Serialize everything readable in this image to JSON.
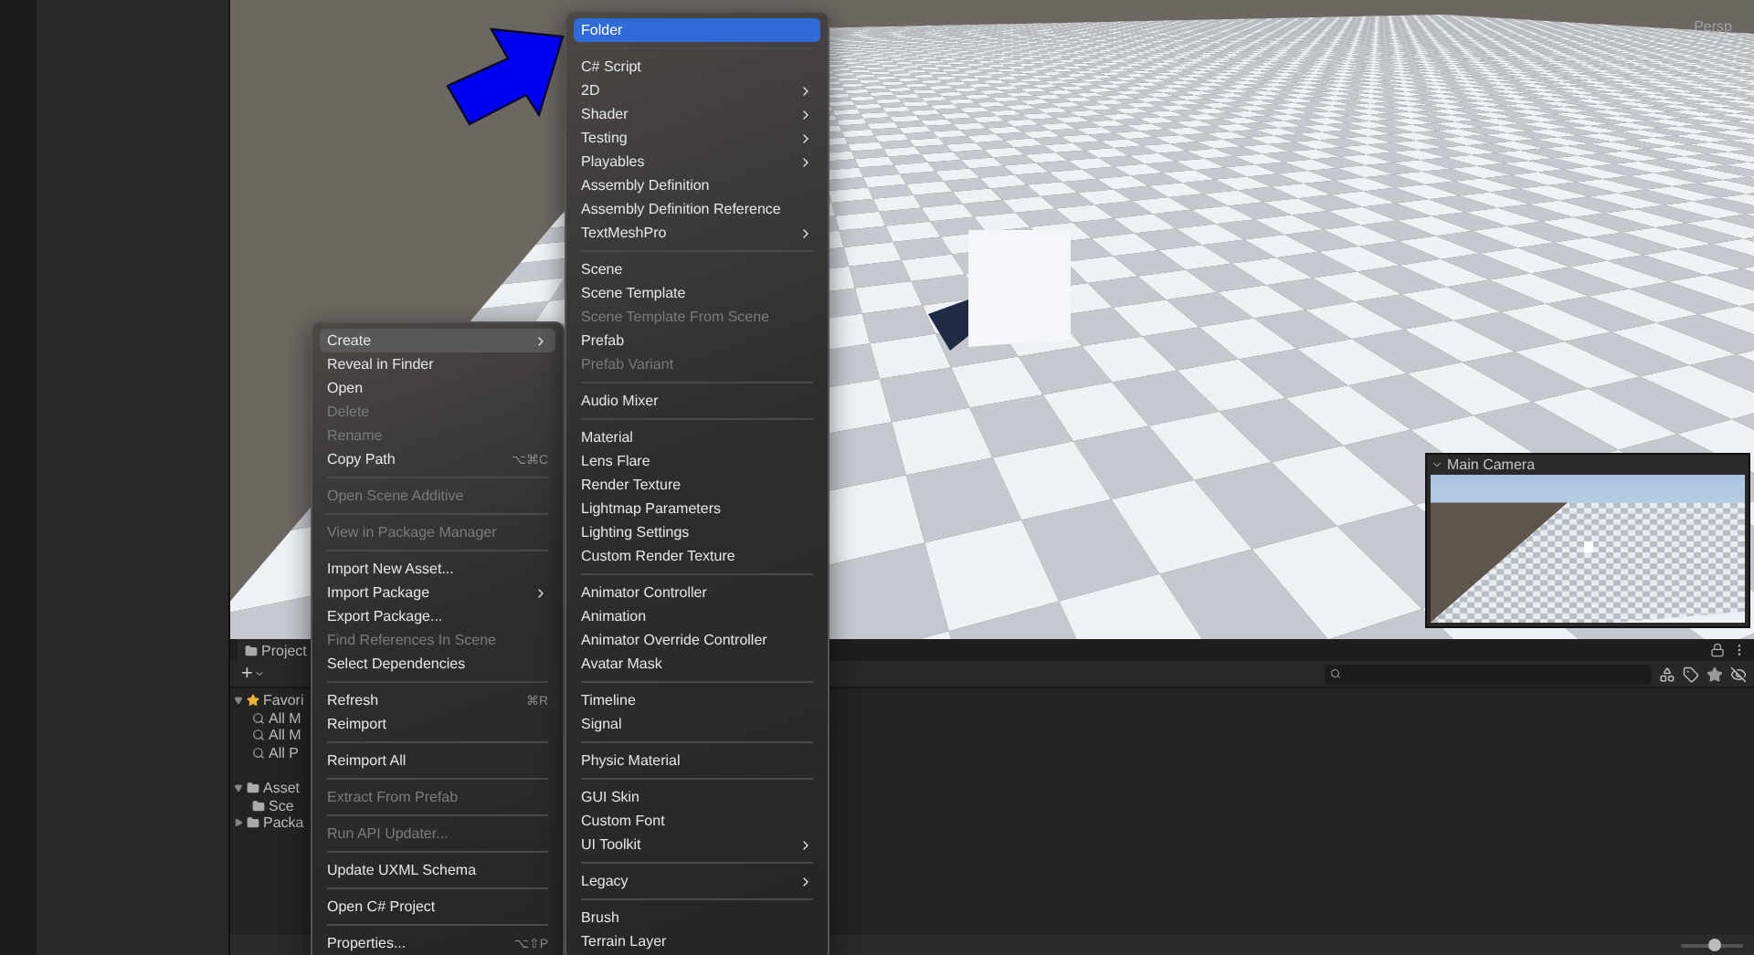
{
  "scene_view": {
    "camera_mode": "Persp",
    "camera_preview": {
      "title": "Main Camera",
      "expanded": true
    }
  },
  "project_panel": {
    "tab": "Project",
    "add_label": "+",
    "tree": [
      {
        "label": "Favori",
        "kind": "favorites",
        "expanded": true,
        "children": [
          {
            "label": "All M",
            "kind": "search"
          },
          {
            "label": "All M",
            "kind": "search"
          },
          {
            "label": "All P",
            "kind": "search"
          }
        ]
      },
      {
        "label": "Asset",
        "kind": "folder",
        "expanded": true,
        "children": [
          {
            "label": "Sce",
            "kind": "folder"
          }
        ]
      },
      {
        "label": "Packa",
        "kind": "folder",
        "expanded": false
      }
    ],
    "zoom_slider": {
      "level": 0.55
    }
  },
  "context_menu": {
    "focused": false,
    "items": [
      {
        "kind": "item",
        "label": "Create",
        "submenu": true,
        "selected": true,
        "disabled": false
      },
      {
        "kind": "item",
        "label": "Reveal in Finder",
        "selected": false,
        "disabled": false
      },
      {
        "kind": "item",
        "label": "Open",
        "selected": false,
        "disabled": false
      },
      {
        "kind": "item",
        "label": "Delete",
        "selected": false,
        "disabled": true
      },
      {
        "kind": "item",
        "label": "Rename",
        "selected": false,
        "disabled": true
      },
      {
        "kind": "item",
        "label": "Copy Path",
        "shortcut": "⌥⌘C",
        "selected": false,
        "disabled": false
      },
      {
        "kind": "separator"
      },
      {
        "kind": "item",
        "label": "Open Scene Additive",
        "selected": false,
        "disabled": true
      },
      {
        "kind": "separator"
      },
      {
        "kind": "item",
        "label": "View in Package Manager",
        "selected": false,
        "disabled": true
      },
      {
        "kind": "separator"
      },
      {
        "kind": "item",
        "label": "Import New Asset...",
        "selected": false,
        "disabled": false
      },
      {
        "kind": "item",
        "label": "Import Package",
        "submenu": true,
        "selected": false,
        "disabled": false
      },
      {
        "kind": "item",
        "label": "Export Package...",
        "selected": false,
        "disabled": false
      },
      {
        "kind": "item",
        "label": "Find References In Scene",
        "selected": false,
        "disabled": true
      },
      {
        "kind": "item",
        "label": "Select Dependencies",
        "selected": false,
        "disabled": false
      },
      {
        "kind": "separator"
      },
      {
        "kind": "item",
        "label": "Refresh",
        "shortcut": "⌘R",
        "selected": false,
        "disabled": false
      },
      {
        "kind": "item",
        "label": "Reimport",
        "selected": false,
        "disabled": false
      },
      {
        "kind": "separator"
      },
      {
        "kind": "item",
        "label": "Reimport All",
        "selected": false,
        "disabled": false
      },
      {
        "kind": "separator"
      },
      {
        "kind": "item",
        "label": "Extract From Prefab",
        "selected": false,
        "disabled": true
      },
      {
        "kind": "separator"
      },
      {
        "kind": "item",
        "label": "Run API Updater...",
        "selected": false,
        "disabled": true
      },
      {
        "kind": "separator"
      },
      {
        "kind": "item",
        "label": "Update UXML Schema",
        "selected": false,
        "disabled": false
      },
      {
        "kind": "separator"
      },
      {
        "kind": "item",
        "label": "Open C# Project",
        "selected": false,
        "disabled": false
      },
      {
        "kind": "separator"
      },
      {
        "kind": "item",
        "label": "Properties...",
        "shortcut": "⌥⇧P",
        "selected": false,
        "disabled": false
      }
    ]
  },
  "create_submenu": {
    "focused": true,
    "items": [
      {
        "kind": "item",
        "label": "Folder",
        "selected": true,
        "disabled": false
      },
      {
        "kind": "separator"
      },
      {
        "kind": "item",
        "label": "C# Script",
        "selected": false,
        "disabled": false
      },
      {
        "kind": "item",
        "label": "2D",
        "submenu": true,
        "selected": false,
        "disabled": false
      },
      {
        "kind": "item",
        "label": "Shader",
        "submenu": true,
        "selected": false,
        "disabled": false
      },
      {
        "kind": "item",
        "label": "Testing",
        "submenu": true,
        "selected": false,
        "disabled": false
      },
      {
        "kind": "item",
        "label": "Playables",
        "submenu": true,
        "selected": false,
        "disabled": false
      },
      {
        "kind": "item",
        "label": "Assembly Definition",
        "selected": false,
        "disabled": false
      },
      {
        "kind": "item",
        "label": "Assembly Definition Reference",
        "selected": false,
        "disabled": false
      },
      {
        "kind": "item",
        "label": "TextMeshPro",
        "submenu": true,
        "selected": false,
        "disabled": false
      },
      {
        "kind": "separator"
      },
      {
        "kind": "item",
        "label": "Scene",
        "selected": false,
        "disabled": false
      },
      {
        "kind": "item",
        "label": "Scene Template",
        "selected": false,
        "disabled": false
      },
      {
        "kind": "item",
        "label": "Scene Template From Scene",
        "selected": false,
        "disabled": true
      },
      {
        "kind": "item",
        "label": "Prefab",
        "selected": false,
        "disabled": false
      },
      {
        "kind": "item",
        "label": "Prefab Variant",
        "selected": false,
        "disabled": true
      },
      {
        "kind": "separator"
      },
      {
        "kind": "item",
        "label": "Audio Mixer",
        "selected": false,
        "disabled": false
      },
      {
        "kind": "separator"
      },
      {
        "kind": "item",
        "label": "Material",
        "selected": false,
        "disabled": false
      },
      {
        "kind": "item",
        "label": "Lens Flare",
        "selected": false,
        "disabled": false
      },
      {
        "kind": "item",
        "label": "Render Texture",
        "selected": false,
        "disabled": false
      },
      {
        "kind": "item",
        "label": "Lightmap Parameters",
        "selected": false,
        "disabled": false
      },
      {
        "kind": "item",
        "label": "Lighting Settings",
        "selected": false,
        "disabled": false
      },
      {
        "kind": "item",
        "label": "Custom Render Texture",
        "selected": false,
        "disabled": false
      },
      {
        "kind": "separator"
      },
      {
        "kind": "item",
        "label": "Animator Controller",
        "selected": false,
        "disabled": false
      },
      {
        "kind": "item",
        "label": "Animation",
        "selected": false,
        "disabled": false
      },
      {
        "kind": "item",
        "label": "Animator Override Controller",
        "selected": false,
        "disabled": false
      },
      {
        "kind": "item",
        "label": "Avatar Mask",
        "selected": false,
        "disabled": false
      },
      {
        "kind": "separator"
      },
      {
        "kind": "item",
        "label": "Timeline",
        "selected": false,
        "disabled": false
      },
      {
        "kind": "item",
        "label": "Signal",
        "selected": false,
        "disabled": false
      },
      {
        "kind": "separator"
      },
      {
        "kind": "item",
        "label": "Physic Material",
        "selected": false,
        "disabled": false
      },
      {
        "kind": "separator"
      },
      {
        "kind": "item",
        "label": "GUI Skin",
        "selected": false,
        "disabled": false
      },
      {
        "kind": "item",
        "label": "Custom Font",
        "selected": false,
        "disabled": false
      },
      {
        "kind": "item",
        "label": "UI Toolkit",
        "submenu": true,
        "selected": false,
        "disabled": false
      },
      {
        "kind": "separator"
      },
      {
        "kind": "item",
        "label": "Legacy",
        "submenu": true,
        "selected": false,
        "disabled": false
      },
      {
        "kind": "separator"
      },
      {
        "kind": "item",
        "label": "Brush",
        "selected": false,
        "disabled": false
      },
      {
        "kind": "item",
        "label": "Terrain Layer",
        "selected": false,
        "disabled": false
      }
    ]
  }
}
